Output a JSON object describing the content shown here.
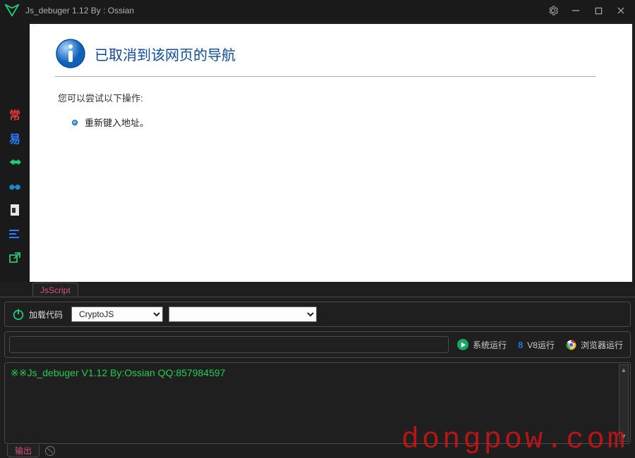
{
  "titlebar": {
    "title": "Js_debuger 1.12 By : Ossian"
  },
  "page": {
    "heading": "已取消到该网页的导航",
    "sub": "您可以尝试以下操作:",
    "bullet1": "重新键入地址。"
  },
  "tabs": {
    "jsscript": "JsScript"
  },
  "load": {
    "label": "加载代码"
  },
  "selects": {
    "lib": "CryptoJS",
    "second": ""
  },
  "input": {
    "value": ""
  },
  "run": {
    "system": "系统运行",
    "v8": "V8运行",
    "browser": "浏览器运行"
  },
  "output": {
    "line1": "※※Js_debuger V1.12 By:Ossian QQ:857984597"
  },
  "bottom": {
    "output_tab": "输出"
  },
  "watermark": "dongpow.com"
}
